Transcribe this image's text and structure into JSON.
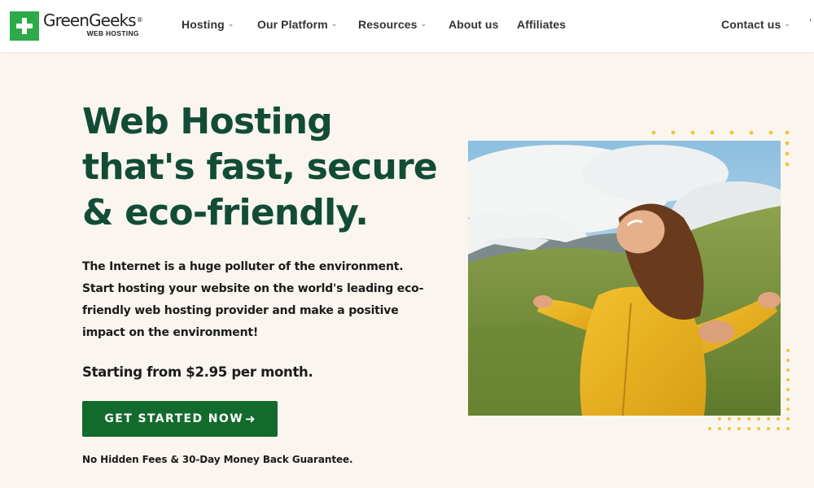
{
  "header": {
    "logo": {
      "name": "GreenGeeks",
      "trademark": "®",
      "sub": "WEB HOSTING"
    },
    "nav": [
      {
        "label": "Hosting",
        "dropdown": true
      },
      {
        "label": "Our Platform",
        "dropdown": true
      },
      {
        "label": "Resources",
        "dropdown": true
      },
      {
        "label": "About us",
        "dropdown": false
      },
      {
        "label": "Affiliates",
        "dropdown": false
      }
    ],
    "contact": {
      "label": "Contact us",
      "dropdown": true
    },
    "chevron_icon": "chevron-down-icon"
  },
  "hero": {
    "title_lines": [
      "Web Hosting",
      "that's fast, secure",
      "& eco-friendly."
    ],
    "description_lines": [
      "The Internet is a huge polluter of the environment.",
      "Start hosting your website on the world's leading eco-",
      "friendly web hosting provider and make a positive",
      "impact on the environment!"
    ],
    "price": "Starting from $2.95 per month.",
    "cta": {
      "label": "GET STARTED NOW",
      "icon": "arrow-right-icon"
    },
    "guarantee": "No Hidden Fees & 30-Day Money Back Guarantee.",
    "image_alt": "woman-in-yellow-jacket-photo"
  },
  "colors": {
    "page_background": "#faf6ef",
    "brand_green": "#2dab4a",
    "title_green": "#124c37",
    "button_green": "#136a2d",
    "dot_yellow": "#f2c43c"
  }
}
